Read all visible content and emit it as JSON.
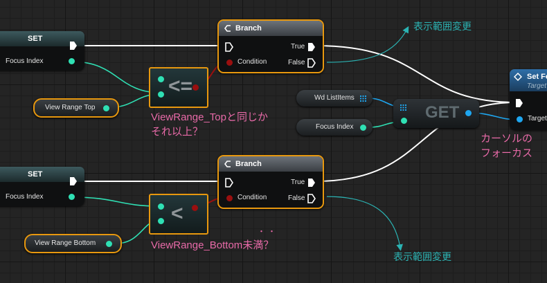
{
  "nodes": {
    "set_top": {
      "title": "SET",
      "pin_label": "Focus Index"
    },
    "set_bottom": {
      "title": "SET",
      "pin_label": "Focus Index"
    },
    "branch_top": {
      "title": "Branch",
      "condition_label": "Condition",
      "true_label": "True",
      "false_label": "False"
    },
    "branch_bottom": {
      "title": "Branch",
      "condition_label": "Condition",
      "true_label": "True",
      "false_label": "False"
    },
    "compare_top": {
      "operator": "<="
    },
    "compare_bottom": {
      "operator": "<"
    },
    "view_range_top": {
      "label": "View Range Top"
    },
    "view_range_bottom": {
      "label": "View Range Bottom"
    },
    "wd_listitems": {
      "label": "Wd ListItems"
    },
    "focus_index_get": {
      "label": "Focus Index"
    },
    "get_node": {
      "label": "GET"
    },
    "set_focus": {
      "title": "Set Fo",
      "subtitle": "Target",
      "target_label": "Target"
    }
  },
  "annotations": {
    "top_false_note": "表示範囲変更",
    "bottom_false_note": "表示範囲変更",
    "compare_top_note_line1": "ViewRange_Topと同じか",
    "compare_top_note_line2": "それ以上？",
    "compare_bottom_note": "ViewRange_Bottom未満？",
    "compare_bottom_dots": "・・",
    "get_note_line1": "カーソルの",
    "get_note_line2": "フォーカス"
  },
  "icons": [
    "exec-pin-icon",
    "branch-icon",
    "array-grid-icon",
    "function-icon"
  ],
  "colors": {
    "exec_wire": "#ffffff",
    "int_wire": "#2fe0b4",
    "bool_wire": "#9a0f0f",
    "object_wire": "#1ea6f0",
    "selection": "#e8980e",
    "note_pink": "#e86aa8",
    "note_cyan": "#2bb3b3"
  }
}
